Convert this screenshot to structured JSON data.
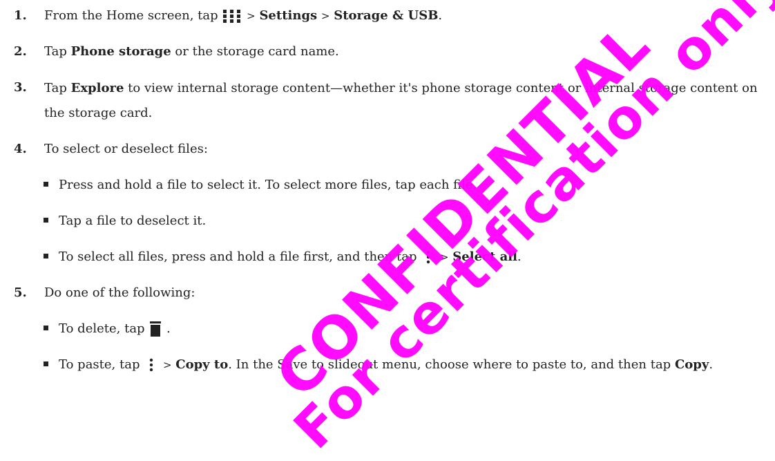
{
  "steps": [
    {
      "num": "1.",
      "p1": "From the Home screen, tap",
      "p2": ">",
      "b1": "Settings",
      "p3": ">",
      "b2": "Storage & USB",
      "p4": "."
    },
    {
      "num": "2.",
      "p1": "Tap",
      "b1": "Phone storage",
      "p2": "or the storage card name."
    },
    {
      "num": "3.",
      "p1": "Tap",
      "b1": "Explore",
      "p2": "to view internal storage content—whether it's phone storage content or internal storage content on the storage card."
    },
    {
      "num": "4.",
      "p1": "To select or deselect files:"
    },
    {
      "num": "5.",
      "p1": "Do one of the following:"
    }
  ],
  "select_bullets": [
    {
      "p1": "Press and hold a file to select it. To select more files, tap each file."
    },
    {
      "p1": "Tap a file to deselect it."
    },
    {
      "p1": "To select all files, press and hold a file first, and then tap",
      "p2": ">",
      "b1": "Select all",
      "p3": "."
    }
  ],
  "action_bullets": [
    {
      "p1": "To delete, tap",
      "p2": "."
    },
    {
      "p1": "To paste, tap",
      "p2": ">",
      "b1": "Copy to",
      "p3": ". In the Save to slideout menu, choose where to paste to, and then tap",
      "b2": "Copy",
      "p4": "."
    }
  ],
  "icons": {
    "apps": "apps-grid-icon",
    "more": "more-vertical-icon",
    "delete": "trash-icon"
  },
  "watermark": {
    "line1": "CONFIDENTIAL",
    "line2": "For certification only",
    "color": "#ff00ff"
  }
}
